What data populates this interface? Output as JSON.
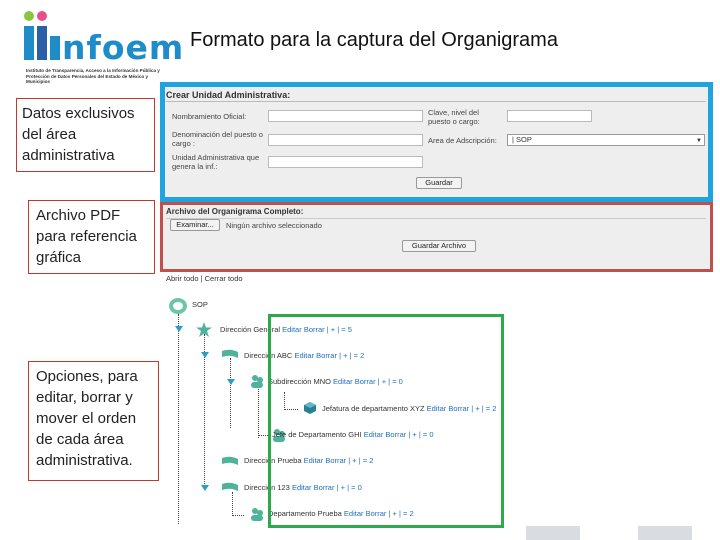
{
  "logo": {
    "word": "nfoem",
    "caption": "Instituto de Transparencia, Acceso a la Información Pública y Protección de Datos Personales del Estado de México y Municipios"
  },
  "title": "Formato para la captura del Organigrama",
  "callouts": {
    "datos": "Datos exclusivos del área administrativa",
    "archivo": "Archivo PDF para referencia gráfica",
    "opciones": "Opciones, para editar, borrar y mover el orden de cada área administrativa."
  },
  "crear": {
    "title": "Crear Unidad Administrativa:",
    "nombramiento_label": "Nombramiento Oficial:",
    "denominacion_label": "Denominación del puesto o cargo :",
    "unidad_label": "Unidad Administrativa que genera la inf.:",
    "clave_label": "Clave, nivel del puesto o cargo:",
    "area_label": "Area de Adscripción:",
    "area_value": "| SOP",
    "guardar": "Guardar"
  },
  "archivo": {
    "title": "Archivo del Organigrama Completo:",
    "examinar": "Examinar...",
    "no_file": "Ningún archivo seleccionado",
    "guardar": "Guardar Archivo"
  },
  "tree_links": "Abrir todo | Cerrar todo",
  "tree": {
    "root": "SOP",
    "nodes": [
      {
        "name": "Dirección General",
        "edit": "Editar",
        "del": "Borrar",
        "order": "| + | = 5"
      },
      {
        "name": "Dirección ABC",
        "edit": "Editar",
        "del": "Borrar",
        "order": "| + | = 2"
      },
      {
        "name": "Subdirección MNO",
        "edit": "Editar",
        "del": "Borrar",
        "order": "| + | = 0"
      },
      {
        "name": "Jefatura de departamento XYZ",
        "edit": "Editar",
        "del": "Borrar",
        "order": "| + | = 2"
      },
      {
        "name": "Jefe de Departamento GHI",
        "edit": "Editar",
        "del": "Borrar",
        "order": "| + | = 0"
      },
      {
        "name": "Dirección Prueba",
        "edit": "Editar",
        "del": "Borrar",
        "order": "| + | = 2"
      },
      {
        "name": "Dirección 123",
        "edit": "Editar",
        "del": "Borrar",
        "order": "| + | = 0"
      },
      {
        "name": "Departamento Prueba",
        "edit": "Editar",
        "del": "Borrar",
        "order": "| + | = 2"
      }
    ]
  },
  "colors": {
    "blue_box": "#1fa4e0",
    "red_box": "#c0504d",
    "green_box": "#2ea84c",
    "logo_blue": "#1e8cc8",
    "link": "#1f6fbf"
  }
}
